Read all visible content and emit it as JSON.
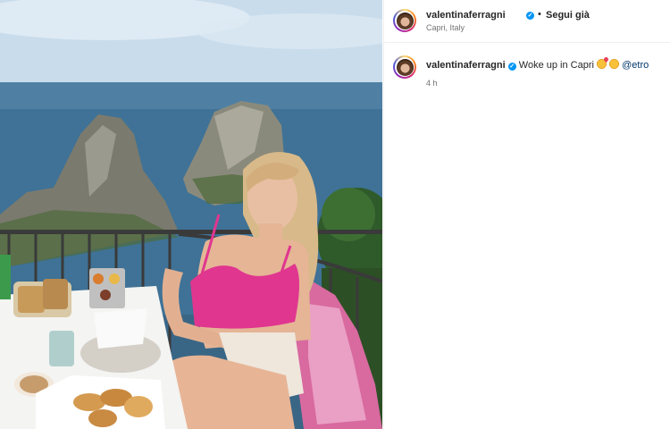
{
  "post": {
    "username": "valentinaferragni",
    "verified_mark": "✓",
    "dot": "•",
    "follow_status": "Segui già",
    "location": "Capri, Italy",
    "caption_text": "Woke up in Capri",
    "caption_mention": "@etro",
    "timestamp": "4 h"
  },
  "icons": [
    "verified-badge-icon",
    "smiling-face-with-hearts-emoji",
    "smiling-face-emoji"
  ],
  "colors": {
    "verified_blue": "#0095f6",
    "mention_blue": "#00376b",
    "secondary_text": "#737373",
    "top_pink": "#e0368f"
  }
}
